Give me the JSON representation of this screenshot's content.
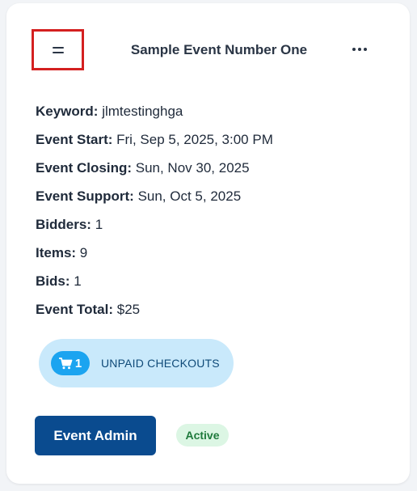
{
  "event": {
    "title": "Sample Event Number One",
    "details": [
      {
        "label": "Keyword:",
        "value": "jlmtestinghga"
      },
      {
        "label": "Event Start:",
        "value": "Fri, Sep 5, 2025, 3:00 PM"
      },
      {
        "label": "Event Closing:",
        "value": "Sun, Nov 30, 2025"
      },
      {
        "label": "Event Support:",
        "value": "Sun, Oct 5, 2025"
      },
      {
        "label": "Bidders:",
        "value": "1"
      },
      {
        "label": "Items:",
        "value": "9"
      },
      {
        "label": "Bids:",
        "value": "1"
      },
      {
        "label": "Event Total:",
        "value": "$25"
      }
    ]
  },
  "checkouts": {
    "count": "1",
    "label": "UNPAID CHECKOUTS",
    "icon": "cart-icon"
  },
  "actions": {
    "admin_label": "Event Admin"
  },
  "status": {
    "label": "Active"
  },
  "icons": {
    "drag": "drag-handle-icon",
    "more": "more-horizontal-icon"
  },
  "colors": {
    "primary_button": "#0a4b8f",
    "checkout_pill": "#c9e9fb",
    "cart_badge": "#1ba4f0",
    "status_bg": "#dcf6e4",
    "status_text": "#1f7a3c",
    "highlight_border": "#d42020"
  }
}
